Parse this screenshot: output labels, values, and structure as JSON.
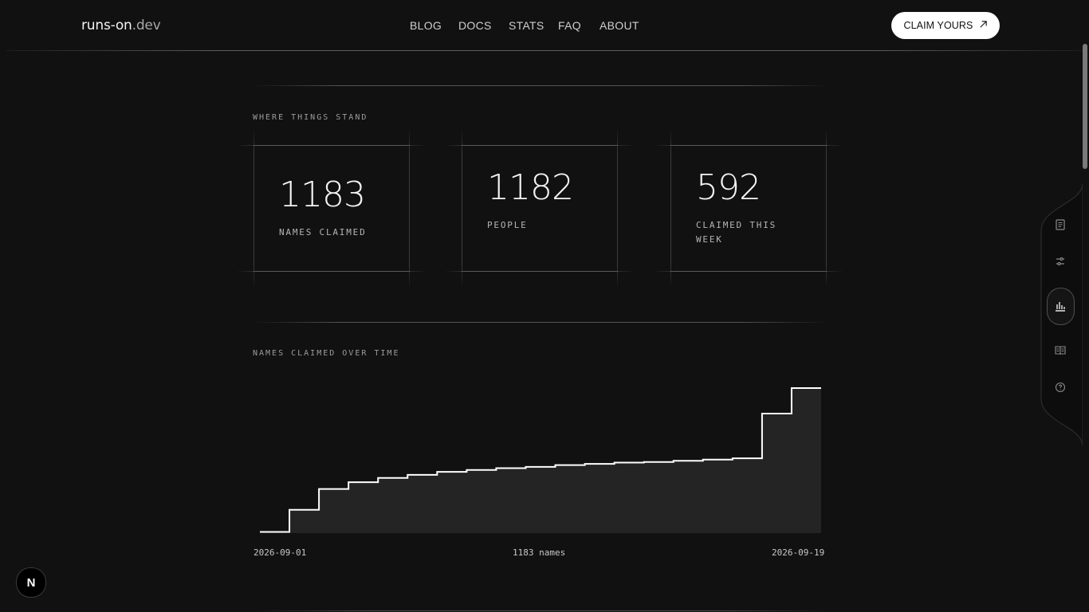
{
  "header": {
    "logo_main": "runs-on",
    "logo_tld": ".dev",
    "nav": [
      "BLOG",
      "DOCS",
      "STATS",
      "FAQ",
      "ABOUT"
    ],
    "cta_label": "CLAIM YOURS"
  },
  "stats_section": {
    "label": "WHERE THINGS STAND",
    "cards": [
      {
        "value": "1183",
        "label": "NAMES CLAIMED"
      },
      {
        "value": "1182",
        "label": "PEOPLE"
      },
      {
        "value": "592",
        "label": "CLAIMED THIS WEEK"
      }
    ]
  },
  "chart_section": {
    "label": "NAMES CLAIMED OVER TIME",
    "x_start": "2026-09-01",
    "x_end": "2026-09-19",
    "center_label": "1183 names"
  },
  "chart_data": {
    "type": "area",
    "title": "NAMES CLAIMED OVER TIME",
    "step": true,
    "x": [
      "2026-09-01",
      "2026-09-02",
      "2026-09-03",
      "2026-09-04",
      "2026-09-05",
      "2026-09-06",
      "2026-09-07",
      "2026-09-08",
      "2026-09-09",
      "2026-09-10",
      "2026-09-11",
      "2026-09-12",
      "2026-09-13",
      "2026-09-14",
      "2026-09-15",
      "2026-09-16",
      "2026-09-17",
      "2026-09-18",
      "2026-09-19"
    ],
    "values": [
      10,
      190,
      360,
      415,
      450,
      475,
      500,
      515,
      530,
      540,
      555,
      565,
      575,
      580,
      590,
      600,
      610,
      975,
      1183
    ],
    "ylim": [
      0,
      1183
    ],
    "grid": false,
    "color": "#ffffff",
    "fill": "#242424"
  },
  "side_rail": {
    "icons": [
      "document-icon",
      "sliders-icon",
      "bar-chart-icon",
      "book-icon",
      "help-circle-icon"
    ],
    "active": "bar-chart-icon"
  },
  "badge": {
    "letter": "N"
  }
}
